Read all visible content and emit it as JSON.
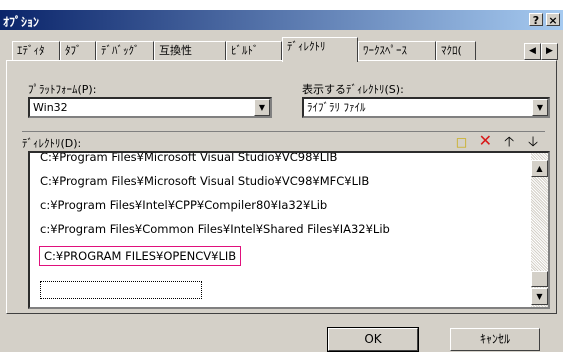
{
  "window": {
    "title": "ｵﾌﾟｼｮﾝ",
    "help_glyph": "?",
    "close_glyph": "×"
  },
  "tabs": [
    {
      "label": "ｴﾃﾞｨﾀ"
    },
    {
      "label": "ﾀﾌﾞ"
    },
    {
      "label": "ﾃﾞﾊﾞｯｸﾞ"
    },
    {
      "label": "互換性"
    },
    {
      "label": "ﾋﾞﾙﾄﾞ"
    },
    {
      "label": "ﾃﾞｨﾚｸﾄﾘ",
      "active": true
    },
    {
      "label": "ﾜｰｸｽﾍﾟｰｽ"
    },
    {
      "label": "ﾏｸﾛ("
    }
  ],
  "platform": {
    "label": "ﾌﾟﾗｯﾄﾌｫｰﾑ(P):",
    "value": "Win32"
  },
  "show_dirs": {
    "label": "表示するﾃﾞｨﾚｸﾄﾘ(S):",
    "value": "ﾗｲﾌﾞﾗﾘ ﾌｧｲﾙ"
  },
  "directories": {
    "label": "ﾃﾞｨﾚｸﾄﾘ(D):",
    "toolbar_icons": [
      "new-folder-icon",
      "delete-icon",
      "move-up-icon",
      "move-down-icon"
    ],
    "items": [
      "C:¥Program Files¥Microsoft Visual Studio¥VC98¥LIB",
      "C:¥Program Files¥Microsoft Visual Studio¥VC98¥MFC¥LIB",
      "c:¥Program Files¥Intel¥CPP¥Compiler80¥Ia32¥Lib",
      "c:¥Program Files¥Common Files¥Intel¥Shared Files¥IA32¥Lib",
      "C:¥PROGRAM FILES¥OPENCV¥LIB"
    ],
    "selected_index": 4,
    "new_entry_value": ""
  },
  "buttons": {
    "ok": "OK",
    "cancel": "ｷｬﾝｾﾙ"
  },
  "colors": {
    "selection_border": "#e0107c",
    "titlebar_start": "#0a246a",
    "titlebar_end": "#a6caf0",
    "delete_icon": "#d81818"
  }
}
